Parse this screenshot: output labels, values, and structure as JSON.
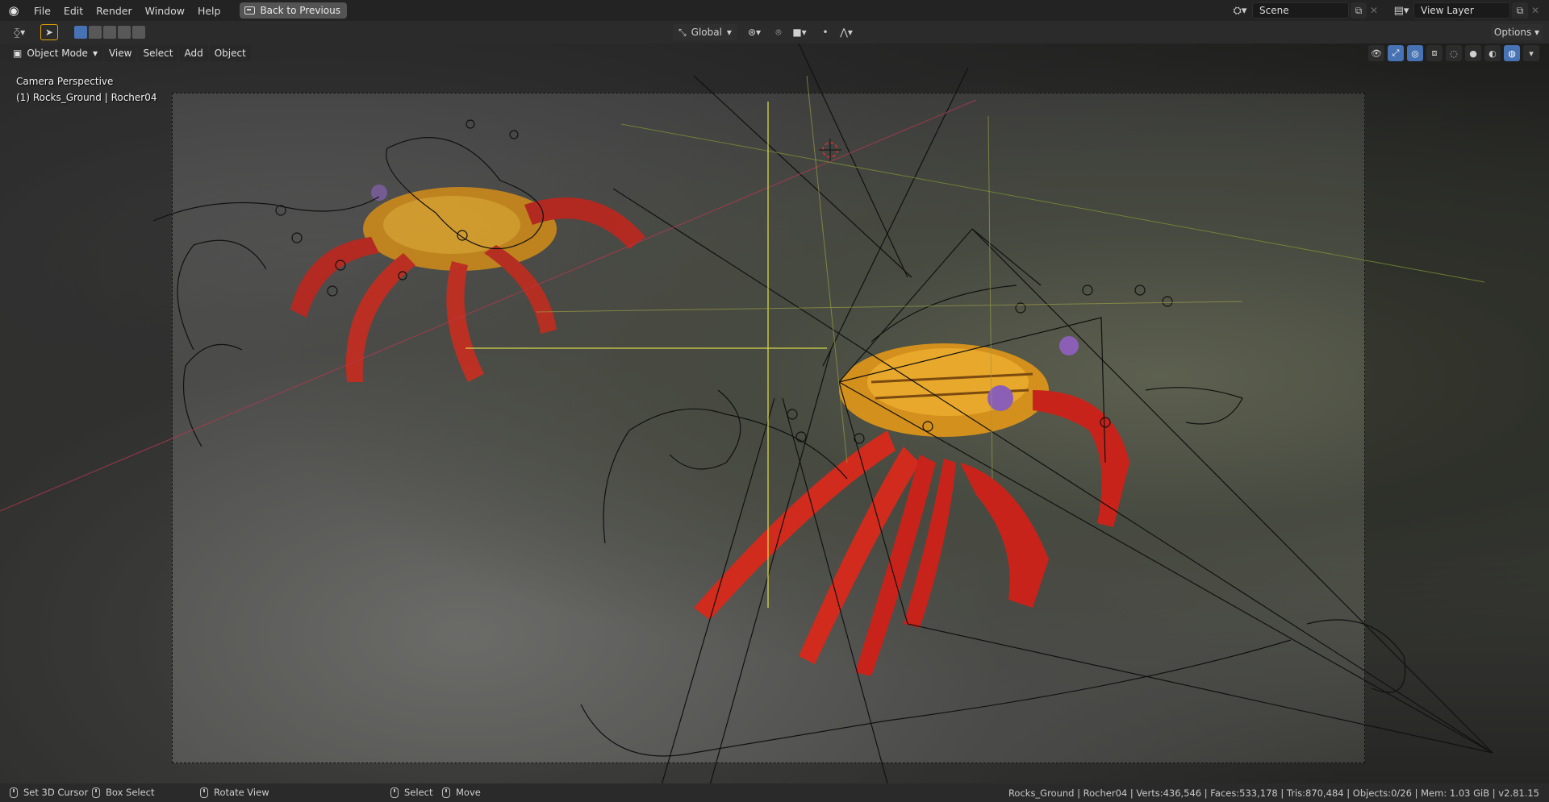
{
  "app": {
    "logo_icon": "blender-logo-icon",
    "menus": [
      "File",
      "Edit",
      "Window",
      "Help"
    ],
    "render_menu": "Render",
    "back_button": "Back to Previous"
  },
  "scene": {
    "label": "Scene",
    "view_layer": "View Layer"
  },
  "toolbar": {
    "transform_orientation": "Global",
    "options": "Options"
  },
  "viewport": {
    "mode": "Object Mode",
    "menus": {
      "view": "View",
      "select": "Select",
      "add": "Add",
      "object": "Object"
    },
    "camera_label": "Camera Perspective",
    "active_object": "(1) Rocks_Ground | Rocher04"
  },
  "statusbar": {
    "set_cursor": "Set 3D Cursor",
    "box_select": "Box Select",
    "rotate_view": "Rotate View",
    "select": "Select",
    "move": "Move",
    "info": "Rocks_Ground | Rocher04 | Verts:436,546 | Faces:533,178 | Tris:870,484 | Objects:0/26 | Mem: 1.03 GiB | v2.81.15"
  },
  "colors": {
    "accent_blue": "#4772b3",
    "active_orange": "#e3a600",
    "crab_red": "#c8231a",
    "crab_orange": "#e59a1c"
  }
}
